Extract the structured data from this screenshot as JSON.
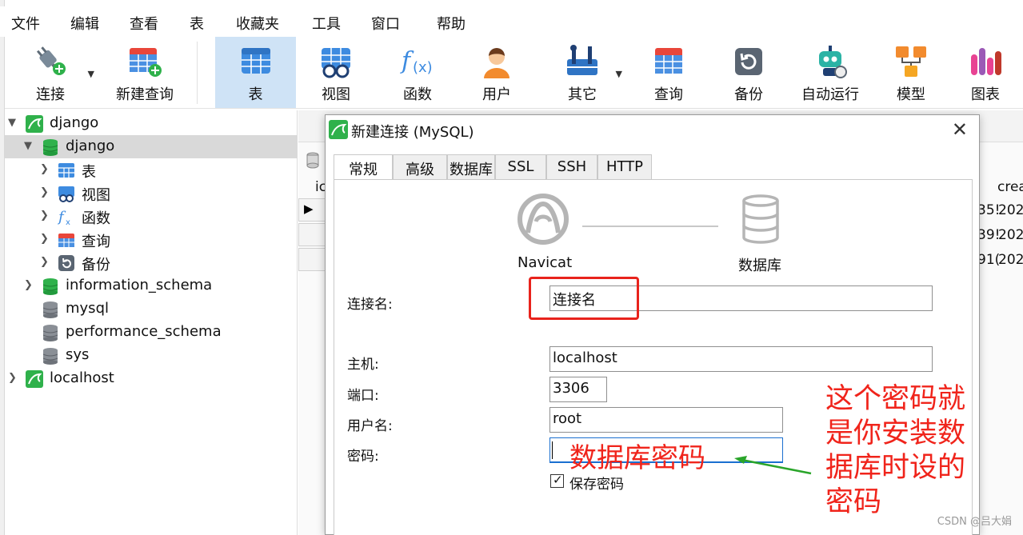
{
  "menu": [
    "文件",
    "编辑",
    "查看",
    "表",
    "收藏夹",
    "工具",
    "窗口",
    "帮助"
  ],
  "toolbar": [
    {
      "label": "连接",
      "icon": "plug-connect-icon",
      "caret": true
    },
    {
      "label": "新建查询",
      "icon": "new-query-icon"
    },
    {
      "label": "表",
      "icon": "table-icon",
      "active": true
    },
    {
      "label": "视图",
      "icon": "view-icon"
    },
    {
      "label": "函数",
      "icon": "function-icon"
    },
    {
      "label": "用户",
      "icon": "user-icon"
    },
    {
      "label": "其它",
      "icon": "tools-icon",
      "caret": true
    },
    {
      "label": "查询",
      "icon": "query-icon"
    },
    {
      "label": "备份",
      "icon": "backup-icon"
    },
    {
      "label": "自动运行",
      "icon": "robot-icon"
    },
    {
      "label": "模型",
      "icon": "model-icon"
    },
    {
      "label": "图表",
      "icon": "chart-icon"
    }
  ],
  "tree": [
    {
      "label": "django",
      "type": "connection",
      "expanded": true
    },
    {
      "label": "django",
      "type": "database",
      "expanded": true,
      "selected": true
    },
    {
      "label": "表",
      "type": "tables"
    },
    {
      "label": "视图",
      "type": "views"
    },
    {
      "label": "函数",
      "type": "functions"
    },
    {
      "label": "查询",
      "type": "queries"
    },
    {
      "label": "备份",
      "type": "backups"
    },
    {
      "label": "information_schema",
      "type": "database"
    },
    {
      "label": "mysql",
      "type": "database-inactive"
    },
    {
      "label": "performance_schema",
      "type": "database-inactive"
    },
    {
      "label": "sys",
      "type": "database-inactive"
    },
    {
      "label": "localhost",
      "type": "connection"
    }
  ],
  "background": {
    "col_id_fragment": "ic",
    "col_crea_fragment": "crea",
    "rows": [
      {
        "left": "35!",
        "right": "202"
      },
      {
        "left": "39!",
        "right": "202"
      },
      {
        "left": "91(",
        "right": "202"
      }
    ]
  },
  "dialog": {
    "title": "新建连接 (MySQL)",
    "close": "✕",
    "tabs": [
      "常规",
      "高级",
      "数据库",
      "SSL",
      "SSH",
      "HTTP"
    ],
    "active_tab": "常规",
    "navicat_label": "Navicat",
    "database_label": "数据库",
    "fields": {
      "conn_name_label": "连接名:",
      "conn_name_value": "连接名",
      "host_label": "主机:",
      "host_value": "localhost",
      "port_label": "端口:",
      "port_value": "3306",
      "user_label": "用户名:",
      "user_value": "root",
      "password_label": "密码:",
      "password_value": "",
      "save_password_label": "保存密码",
      "save_password_checked": true
    }
  },
  "annotations": {
    "password_hint": "数据库密码",
    "note_lines": [
      "这个密码就",
      "是你安装数",
      "据库时设的",
      "密码"
    ],
    "watermark": "CSDN @吕大娟"
  },
  "colors": {
    "accent_red": "#f0241b",
    "arrow_green": "#2aa52a",
    "selection": "#cfe3f6"
  }
}
